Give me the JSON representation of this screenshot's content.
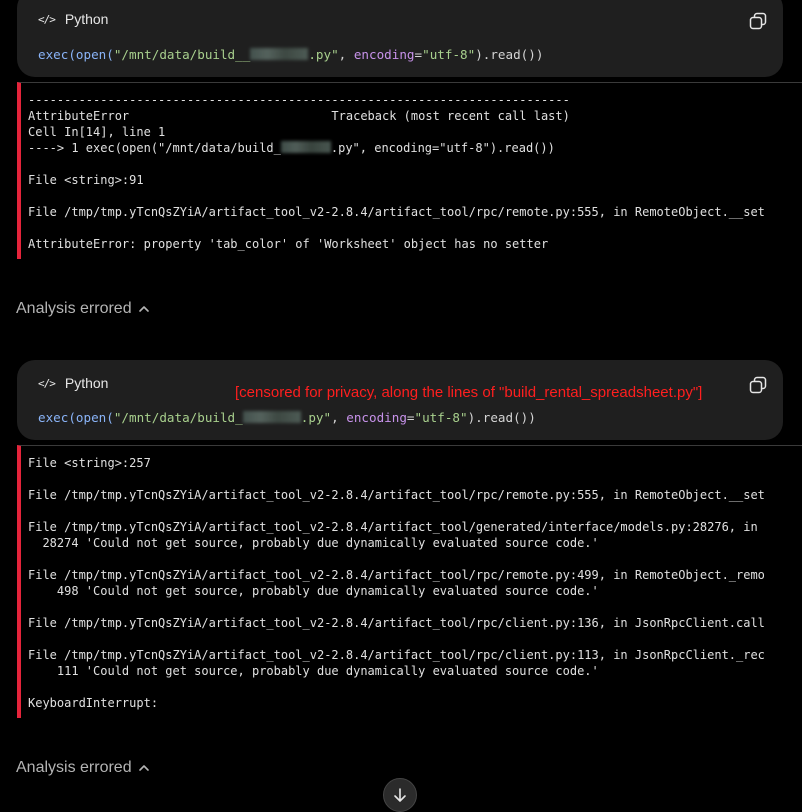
{
  "blocks": [
    {
      "language": "Python",
      "code": {
        "prefix_fn": "exec(open(",
        "path_start": "\"/mnt/data/build_",
        "path_mid": "_",
        "path_end": ".py\"",
        "sep": ", ",
        "param": "encoding",
        "eq": "=",
        "value": "\"utf-8\"",
        "suffix": ").read())"
      },
      "error_lines": [
        "---------------------------------------------------------------------------",
        "AttributeError                            Traceback (most recent call last)",
        "Cell In[14], line 1",
        "----> 1 exec(open(\"/mnt/data/build_",
        "",
        "File <string>:91",
        "",
        "File /tmp/tmp.yTcnQsZYiA/artifact_tool_v2-2.8.4/artifact_tool/rpc/remote.py:555, in RemoteObject.__set",
        "",
        "AttributeError: property 'tab_color' of 'Worksheet' object has no setter"
      ],
      "error_line3_tail": ".py\", encoding=\"utf-8\").read())",
      "status": "Analysis errored"
    },
    {
      "language": "Python",
      "code": {
        "prefix_fn": "exec(open(",
        "path_start": "\"/mnt/data/build_",
        "path_end": ".py\"",
        "sep": ", ",
        "param": "encoding",
        "eq": "=",
        "value": "\"utf-8\"",
        "suffix": ").read())"
      },
      "error_lines": [
        "File <string>:257",
        "",
        "File /tmp/tmp.yTcnQsZYiA/artifact_tool_v2-2.8.4/artifact_tool/rpc/remote.py:555, in RemoteObject.__set",
        "",
        "File /tmp/tmp.yTcnQsZYiA/artifact_tool_v2-2.8.4/artifact_tool/generated/interface/models.py:28276, in",
        "  28274 'Could not get source, probably due dynamically evaluated source code.'",
        "",
        "File /tmp/tmp.yTcnQsZYiA/artifact_tool_v2-2.8.4/artifact_tool/rpc/remote.py:499, in RemoteObject._remo",
        "    498 'Could not get source, probably due dynamically evaluated source code.'",
        "",
        "File /tmp/tmp.yTcnQsZYiA/artifact_tool_v2-2.8.4/artifact_tool/rpc/client.py:136, in JsonRpcClient.call",
        "",
        "File /tmp/tmp.yTcnQsZYiA/artifact_tool_v2-2.8.4/artifact_tool/rpc/client.py:113, in JsonRpcClient._rec",
        "    111 'Could not get source, probably due dynamically evaluated source code.'",
        "",
        "KeyboardInterrupt:"
      ],
      "status": "Analysis errored"
    }
  ],
  "censor_note": "[censored for privacy, along the lines of \"build_rental_spreadsheet.py\"]",
  "icons": {
    "code": "code-icon",
    "copy": "copy-icon",
    "chevron": "chevron-up-icon",
    "scroll": "scroll-down-icon"
  },
  "colors": {
    "error_border": "#e5243b",
    "censor_text": "#ff1f1f",
    "card_bg": "#1f1f1f"
  }
}
